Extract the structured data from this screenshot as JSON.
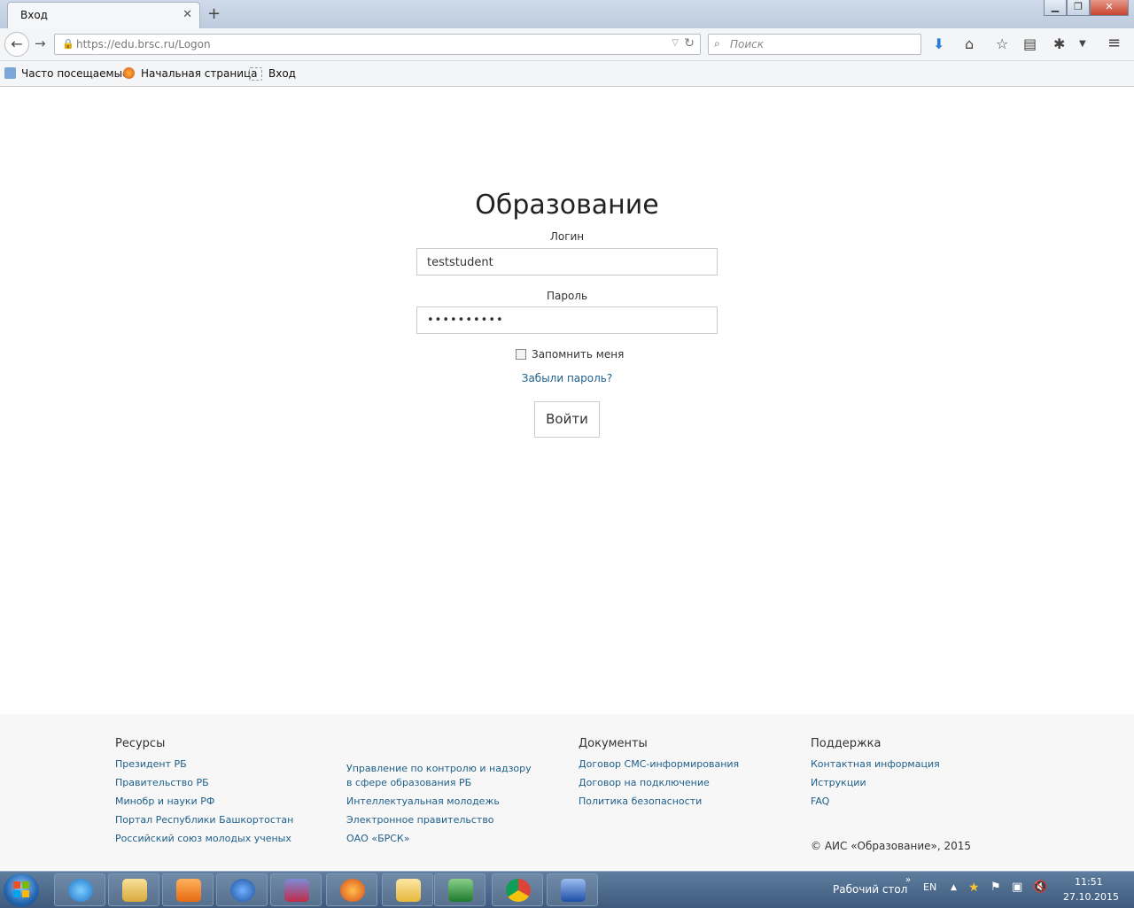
{
  "browser": {
    "tab_title": "Вход",
    "url": "https://edu.brsc.ru/Logon",
    "search_placeholder": "Поиск",
    "bookmarks": [
      "Часто посещаемые",
      "Начальная страница",
      "Вход"
    ]
  },
  "login": {
    "title": "Образование",
    "login_label": "Логин",
    "login_value": "teststudent",
    "password_label": "Пароль",
    "password_value": "••••••••••",
    "remember_label": "Запомнить меня",
    "forgot_label": "Забыли пароль?",
    "submit_label": "Войти"
  },
  "footer": {
    "resources_title": "Ресурсы",
    "resources_col1": [
      "Президент РБ",
      "Правительство РБ",
      "Минобр и науки РФ",
      "Портал Республики Башкортостан",
      "Российский союз молодых ученых"
    ],
    "resources_col2": [
      "Управление по контролю и надзору в сфере образования РБ",
      "Интеллектуальная молодежь",
      "Электронное правительство",
      "ОАО «БРСК»"
    ],
    "documents_title": "Документы",
    "documents": [
      "Договор СМС-информирования",
      "Договор на подключение",
      "Политика безопасности"
    ],
    "support_title": "Поддержка",
    "support": [
      "Контактная информация",
      "Иструкции",
      "FAQ"
    ],
    "copyright": "© АИС «Образование», 2015"
  },
  "taskbar": {
    "desktop_label": "Рабочий стол",
    "lang": "EN",
    "time": "11:51",
    "date": "27.10.2015"
  }
}
